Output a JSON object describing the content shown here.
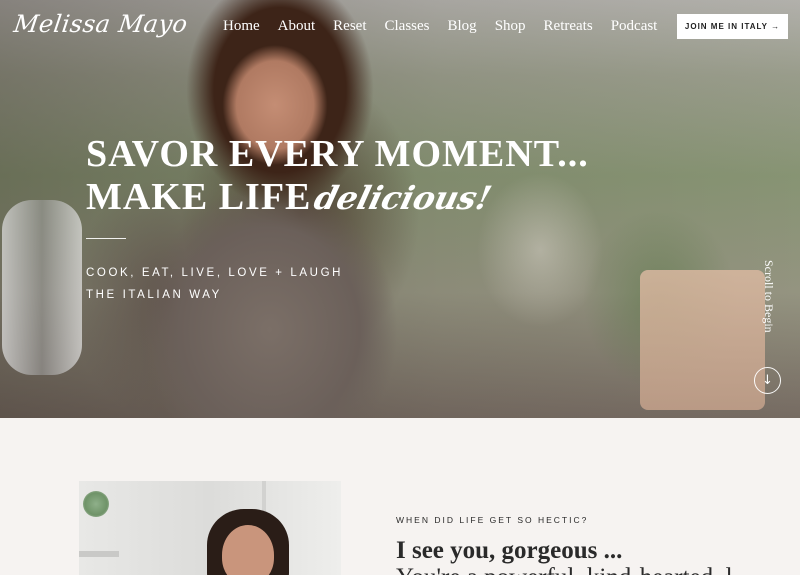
{
  "header": {
    "logo_text": "Melissa Mayo",
    "nav": [
      "Home",
      "About",
      "Reset",
      "Classes",
      "Blog",
      "Shop",
      "Retreats",
      "Podcast"
    ],
    "cta_label": "JOIN ME IN ITALY →"
  },
  "hero": {
    "headline_line1": "SAVOR EVERY MOMENT...",
    "headline_line2": "MAKE LIFE",
    "headline_script": "delicious!",
    "tagline_line1": "COOK, EAT, LIVE, LOVE + LAUGH",
    "tagline_line2": "THE ITALIAN WAY",
    "scroll_label": "Scroll to Begin",
    "scroll_icon": "arrow-down-circle-icon"
  },
  "intro": {
    "eyebrow": "WHEN DID LIFE GET SO HECTIC?",
    "heading": "I see you, gorgeous ...",
    "heading_cont": "You're a powerful, kind-hearted, l"
  },
  "colors": {
    "page_bg": "#f6f3f1",
    "hero_text": "#ffffff",
    "body_text": "#2a2a2a",
    "cta_bg": "#ffffff"
  }
}
